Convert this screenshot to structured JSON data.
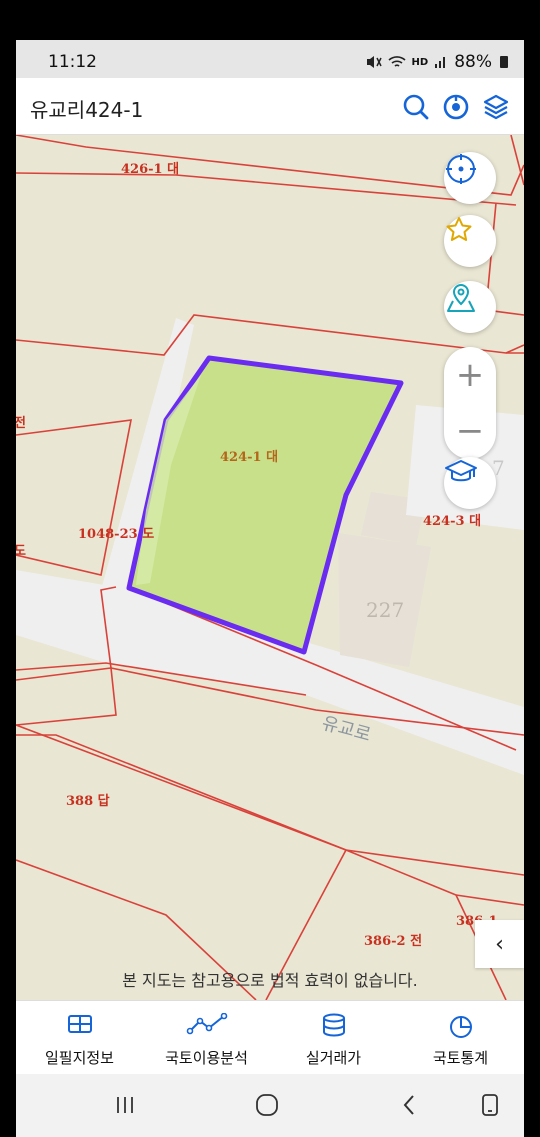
{
  "status_bar": {
    "time": "11:12",
    "hd_label": "HD",
    "battery": "88%"
  },
  "header": {
    "title": "유교리424-1"
  },
  "map": {
    "labels": {
      "parcel_426_1": "426-1 대",
      "parcel_424_1": "424-1 대",
      "parcel_424_3": "424-3 대",
      "parcel_1048": "1048-23 도",
      "parcel_left_partial": "전",
      "parcel_left_partial_2": "도",
      "parcel_388": "388 답",
      "parcel_386_2": "386-2 전",
      "parcel_386_partial": "386-1",
      "building_227": "227",
      "building_227_partial": "7",
      "road": "유교로"
    },
    "highlight_color": "#6a2cf0",
    "highlight_fill": "#c9e08a",
    "parcel_line_color": "#d9423a",
    "label_color": "#c8301f"
  },
  "controls": {
    "zoom_in": "+",
    "zoom_out": "−",
    "collapse": "‹"
  },
  "disclaimer": "본 지도는 참고용으로 법적 효력이 없습니다.",
  "bottom_nav": [
    {
      "label": "일필지정보"
    },
    {
      "label": "국토이용분석"
    },
    {
      "label": "실거래가"
    },
    {
      "label": "국토통계"
    }
  ],
  "accent_color": "#1565d8"
}
